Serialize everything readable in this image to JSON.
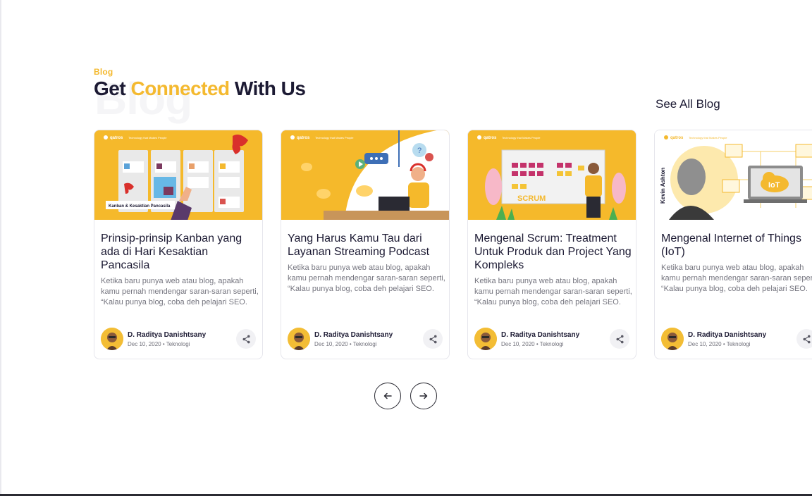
{
  "section": {
    "kicker": "Blog",
    "ghost": "Blog",
    "title_part1": "Get ",
    "title_accent": "Connected",
    "title_part2": " With Us",
    "see_all": "See All Blog"
  },
  "colors": {
    "accent": "#f4b92f",
    "heading": "#1c1a33",
    "muted_text": "#75757f"
  },
  "cards": [
    {
      "title": "Prinsip-prinsip Kanban yang ada di Hari Kesaktian Pancasila",
      "excerpt": "Ketika baru punya web atau blog, apakah kamu pernah mendengar saran-saran seperti, “Kalau punya blog, coba deh pelajari SEO.",
      "author": "D. Raditya Danishtsany",
      "date": "Dec 10, 2020",
      "category": "Teknologi",
      "thumb_caption": "Kanban & Kesaktian Pancasila",
      "thumb_brand": "qatros",
      "thumb_tagline": "Technology that Makes People"
    },
    {
      "title": "Yang Harus Kamu Tau dari Layanan Streaming Podcast",
      "excerpt": "Ketika baru punya web atau blog, apakah kamu pernah mendengar saran-saran seperti, “Kalau punya blog, coba deh pelajari SEO.",
      "author": "D. Raditya Danishtsany",
      "date": "Dec 10, 2020",
      "category": "Teknologi",
      "thumb_brand": "qatros",
      "thumb_tagline": "Technology that Makes People"
    },
    {
      "title": "Mengenal Scrum: Treatment Untuk Produk dan Project Yang Kompleks",
      "excerpt": "Ketika baru punya web atau blog, apakah kamu pernah mendengar saran-saran seperti, “Kalau punya blog, coba deh pelajari SEO.",
      "author": "D. Raditya Danishtsany",
      "date": "Dec 10, 2020",
      "category": "Teknologi",
      "thumb_caption": "SCRUM",
      "thumb_brand": "qatros",
      "thumb_tagline": "Technology that Makes People"
    },
    {
      "title": "Mengenal Internet of Things (IoT)",
      "excerpt": "Ketika baru punya web atau blog, apakah kamu pernah mendengar saran-saran seperti, “Kalau punya blog, coba deh pelajari SEO.",
      "author": "D. Raditya Danishtsany",
      "date": "Dec 10, 2020",
      "category": "Teknologi",
      "thumb_caption": "IoT",
      "thumb_person": "Kevin Ashton",
      "thumb_brand": "qatros",
      "thumb_tagline": "Technology that Makes People"
    }
  ],
  "separator": "•",
  "icons": {
    "share": "share-icon",
    "prev": "arrow-left-icon",
    "next": "arrow-right-icon"
  }
}
